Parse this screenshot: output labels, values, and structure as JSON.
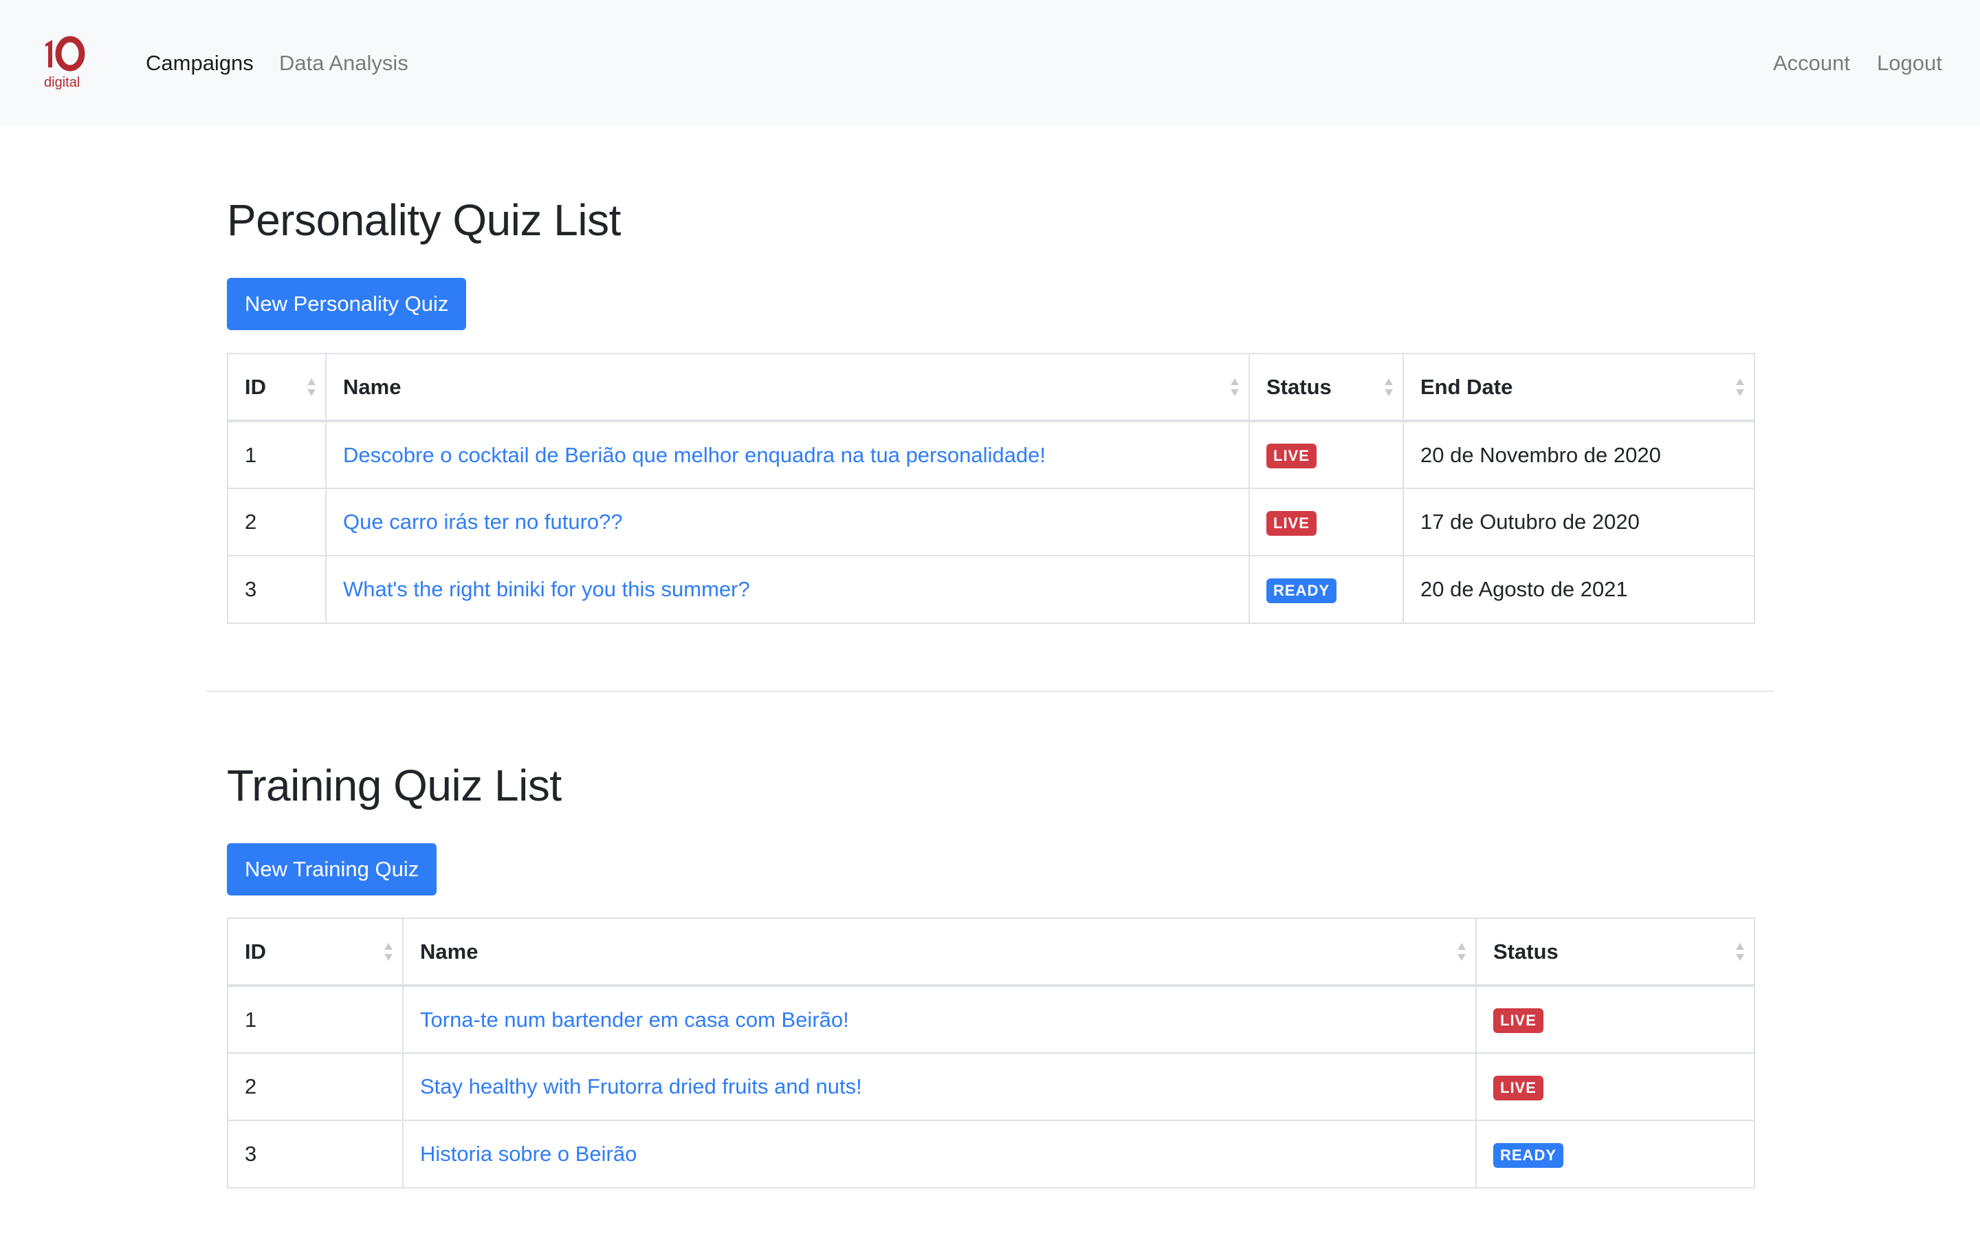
{
  "navbar": {
    "logo": {
      "number": "10",
      "word": "digital",
      "color": "#b32a33"
    },
    "links": [
      {
        "label": "Campaigns",
        "active": true
      },
      {
        "label": "Data Analysis",
        "active": false
      }
    ],
    "account_label": "Account",
    "logout_label": "Logout"
  },
  "personality": {
    "title": "Personality Quiz List",
    "new_button": "New Personality Quiz",
    "columns": [
      "ID",
      "Name",
      "Status",
      "End Date"
    ],
    "rows": [
      {
        "id": "1",
        "name": "Descobre o cocktail de Berião que melhor enquadra na tua personalidade!",
        "status": "LIVE",
        "end_date": "20 de Novembro de 2020"
      },
      {
        "id": "2",
        "name": "Que carro irás ter no futuro??",
        "status": "LIVE",
        "end_date": "17 de Outubro de 2020"
      },
      {
        "id": "3",
        "name": "What's the right biniki for you this summer?",
        "status": "READY",
        "end_date": "20 de Agosto de 2021"
      }
    ]
  },
  "training": {
    "title": "Training Quiz List",
    "new_button": "New Training Quiz",
    "columns": [
      "ID",
      "Name",
      "Status"
    ],
    "rows": [
      {
        "id": "1",
        "name": "Torna-te num bartender em casa com Beirão!",
        "status": "LIVE"
      },
      {
        "id": "2",
        "name": "Stay healthy with Frutorra dried fruits and nuts!",
        "status": "LIVE"
      },
      {
        "id": "3",
        "name": "Historia sobre o Beirão",
        "status": "READY"
      }
    ]
  },
  "colors": {
    "primary": "#2f7df6",
    "live_badge": "#d13b44",
    "ready_badge": "#2f7df6",
    "navbar_bg": "#f8f9fa"
  },
  "icons": {
    "sort": "sort-arrows-icon",
    "brand": "brand-logo"
  }
}
